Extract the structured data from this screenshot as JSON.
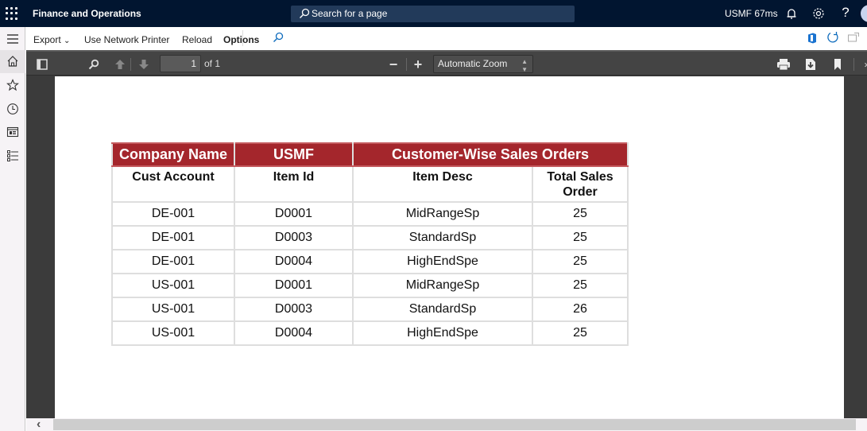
{
  "topbar": {
    "app_title": "Finance and Operations",
    "search_placeholder": "Search for a page",
    "company_perf": "USMF 67ms",
    "icons": [
      "waffle-icon",
      "search-icon",
      "bell-icon",
      "gear-icon",
      "help-icon",
      "avatar"
    ]
  },
  "navpane": {
    "items": [
      "hamburger-icon",
      "home-icon",
      "star-icon",
      "clock-icon",
      "workspace-icon",
      "list-icon"
    ]
  },
  "actionbar": {
    "export_label": "Export",
    "network_printer_label": "Use Network Printer",
    "reload_label": "Reload",
    "options_label": "Options",
    "right_icons": [
      "office-icon",
      "refresh-icon",
      "popout-icon"
    ]
  },
  "pdf_toolbar": {
    "page_number": "1",
    "page_of": "of 1",
    "zoom_label": "Automatic Zoom",
    "zoom_out_symbol": "−",
    "zoom_in_symbol": "+"
  },
  "report": {
    "title_row": {
      "company_label": "Company Name",
      "company_value": "USMF",
      "report_title": "Customer-Wise Sales Orders"
    },
    "columns": [
      "Cust Account",
      "Item Id",
      "Item Desc",
      "Total Sales Order"
    ],
    "rows": [
      [
        "DE-001",
        "D0001",
        "MidRangeSp",
        "25"
      ],
      [
        "DE-001",
        "D0003",
        "StandardSp",
        "25"
      ],
      [
        "DE-001",
        "D0004",
        "HighEndSpe",
        "25"
      ],
      [
        "US-001",
        "D0001",
        "MidRangeSp",
        "25"
      ],
      [
        "US-001",
        "D0003",
        "StandardSp",
        "26"
      ],
      [
        "US-001",
        "D0004",
        "HighEndSpe",
        "25"
      ]
    ]
  },
  "colors": {
    "topbar_bg": "#011530",
    "report_header_bg": "#a4262c",
    "accent_blue": "#0f6cbd"
  }
}
